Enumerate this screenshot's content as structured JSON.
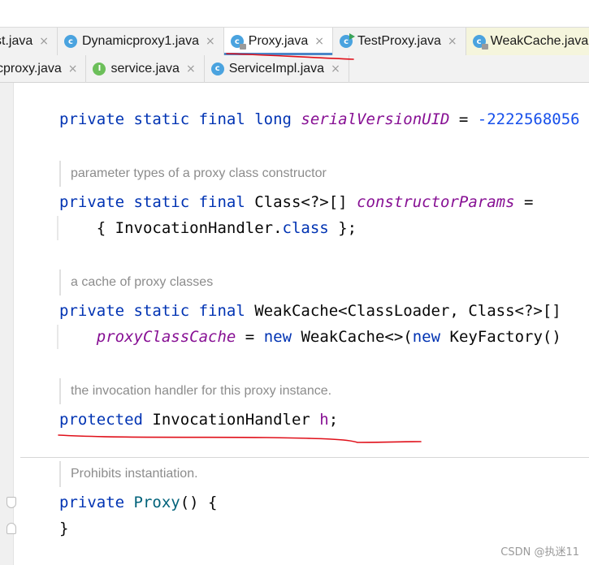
{
  "tabs_row1": [
    {
      "label": "st.java",
      "icon": "none",
      "active": false
    },
    {
      "label": "Dynamicproxy1.java",
      "icon": "class-icon",
      "active": false
    },
    {
      "label": "Proxy.java",
      "icon": "locked-class-icon",
      "active": true
    },
    {
      "label": "TestProxy.java",
      "icon": "runnable-class-icon",
      "active": false
    },
    {
      "label": "WeakCache.java",
      "icon": "locked-class-icon",
      "active": false
    }
  ],
  "tabs_row2": [
    {
      "label": "cproxy.java",
      "icon": "none"
    },
    {
      "label": "service.java",
      "icon": "interface-icon"
    },
    {
      "label": "ServiceImpl.java",
      "icon": "class-icon"
    }
  ],
  "close_glyph": "×",
  "icon_letters": {
    "class": "c",
    "interface": "I"
  },
  "code": {
    "line1": {
      "kw": "private static final long ",
      "field": "serialVersionUID",
      "op": " = ",
      "num": "-2222568056"
    },
    "doc1": "parameter types of a proxy class constructor",
    "line2": {
      "kw": "private static final ",
      "type": "Class<?>[] ",
      "field": "constructorParams",
      "op": " ="
    },
    "line3": {
      "pre": "    { InvocationHandler.",
      "kw": "class",
      "post": " };"
    },
    "doc2": "a cache of proxy classes",
    "line4": {
      "kw": "private static final ",
      "type": "WeakCache<ClassLoader, Class<?>[]"
    },
    "line5": {
      "indent": "    ",
      "field": "proxyClassCache",
      "op": " = ",
      "kw1": "new",
      "mid": " WeakCache<>(",
      "kw2": "new",
      "post": " KeyFactory()"
    },
    "doc3": "the invocation handler for this proxy instance.",
    "line6": {
      "kw": "protected",
      "type": " InvocationHandler ",
      "field": "h",
      "post": ";"
    },
    "doc4": "Prohibits instantiation.",
    "line7": {
      "kw": "private ",
      "method": "Proxy",
      "post": "() {"
    },
    "line8": "}"
  },
  "colors": {
    "keyword": "#0033b3",
    "field": "#871094",
    "number": "#1750eb",
    "doc_comment": "#8c8c8c",
    "annotation_red": "#e0101a",
    "active_tab_underline": "#4a86c8"
  },
  "watermark": "CSDN @执迷11"
}
